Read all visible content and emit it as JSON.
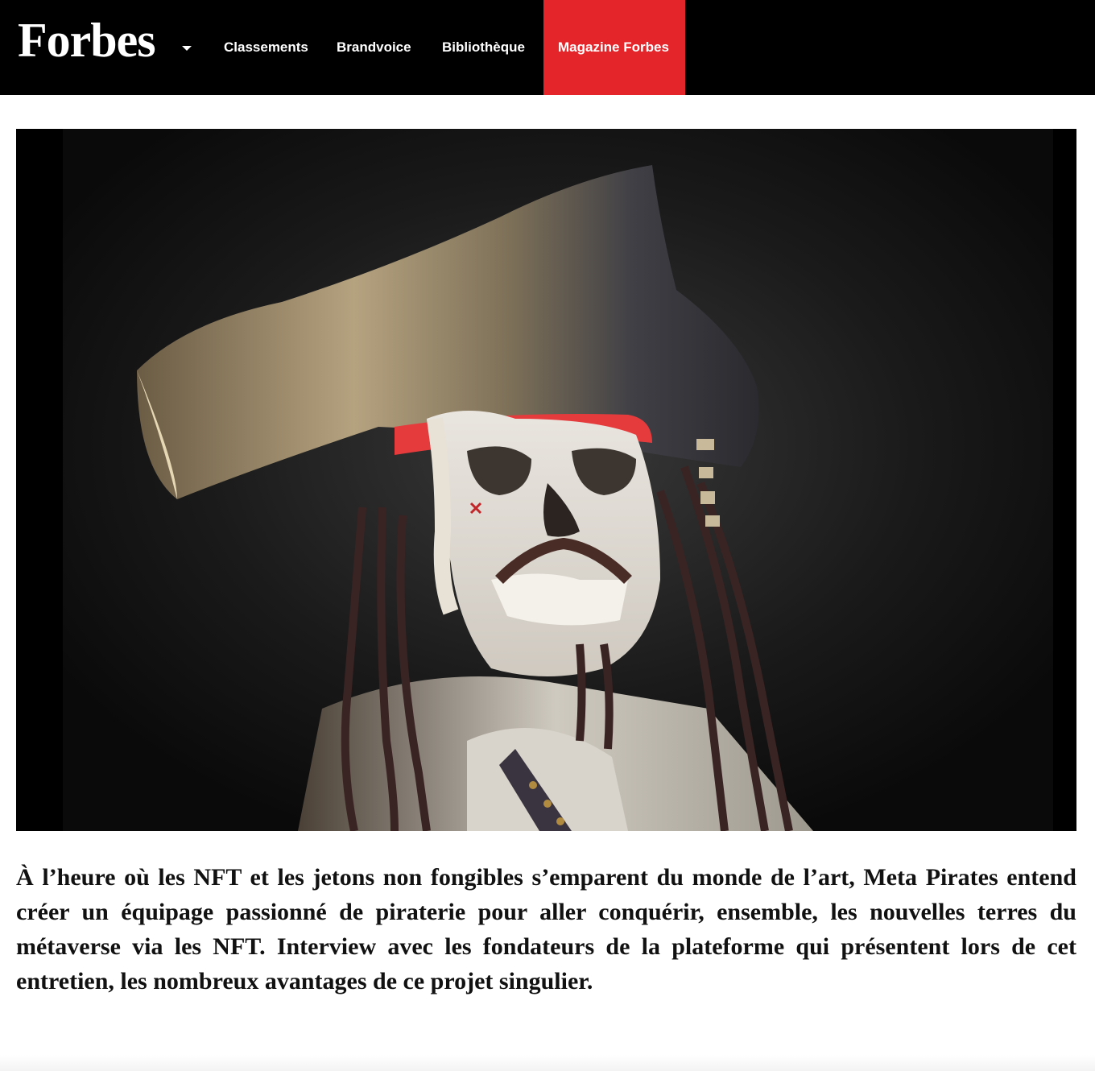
{
  "header": {
    "logo_text": "Forbes",
    "nav": [
      {
        "label": "Classements"
      },
      {
        "label": "Brandvoice"
      },
      {
        "label": "Bibliothèque"
      },
      {
        "label": "Magazine Forbes"
      }
    ]
  },
  "hero": {
    "alt": "Meta Pirates NFT skeleton pirate"
  },
  "article": {
    "intro": "À l’heure où les NFT et les jetons non fongibles s’emparent du monde de l’art, Meta Pirates entend créer un équipage passionné de piraterie pour aller conquérir, ensemble, les nouvelles terres du métaverse via les NFT. Interview avec les fondateurs de la plateforme qui présentent lors de cet entretien, les nombreux avantages de ce projet singulier."
  },
  "colors": {
    "topbar": "#000000",
    "accent": "#e4262b",
    "text": "#111111"
  }
}
